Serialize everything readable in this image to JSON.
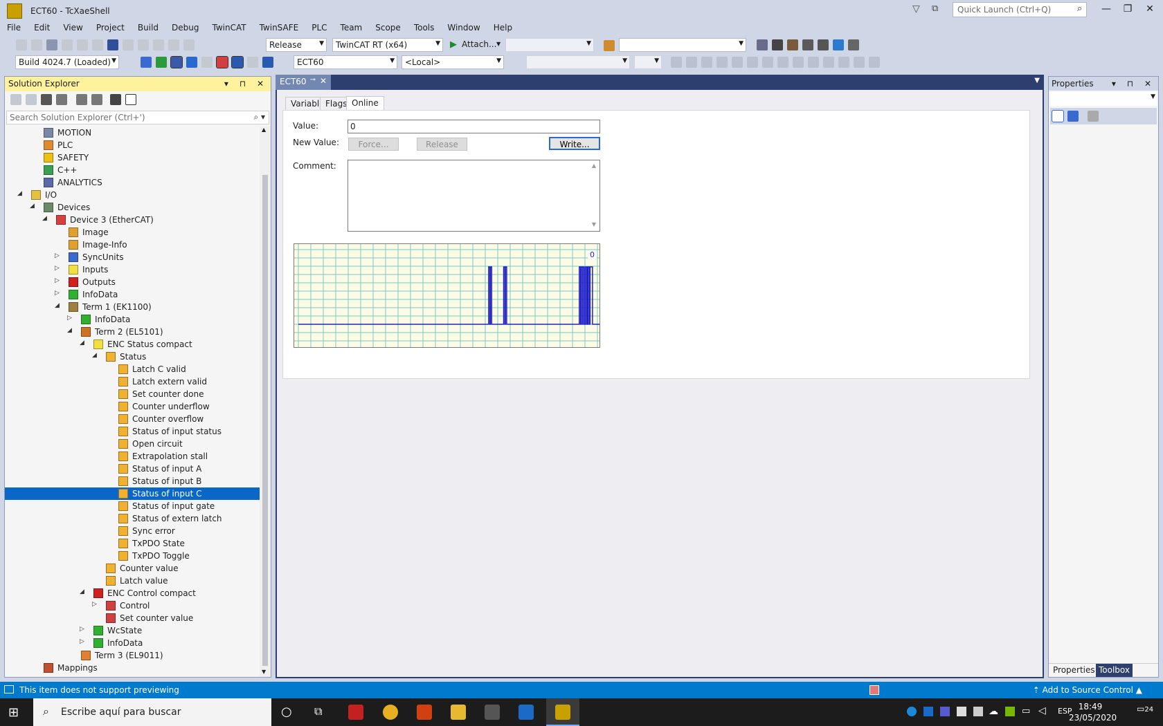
{
  "window": {
    "title": "ECT60 - TcXaeShell",
    "quick_launch_placeholder": "Quick Launch (Ctrl+Q)"
  },
  "menu": [
    "File",
    "Edit",
    "View",
    "Project",
    "Build",
    "Debug",
    "TwinCAT",
    "TwinSAFE",
    "PLC",
    "Team",
    "Scope",
    "Tools",
    "Window",
    "Help"
  ],
  "toolbar": {
    "configuration": "Release",
    "platform": "TwinCAT RT (x64)",
    "attach_label": "Attach...",
    "build_version": "Build 4024.7 (Loaded)",
    "target_project": "ECT60",
    "target_system": "<Local>"
  },
  "solution_explorer": {
    "title": "Solution Explorer",
    "search_placeholder": "Search Solution Explorer (Ctrl+')",
    "items": [
      {
        "label": "MOTION",
        "icon": "motion-icon",
        "color": "#7a88a8"
      },
      {
        "label": "PLC",
        "icon": "plc-icon",
        "color": "#e08a30"
      },
      {
        "label": "SAFETY",
        "icon": "safety-icon",
        "color": "#f0c010"
      },
      {
        "label": "C++",
        "icon": "cpp-icon",
        "color": "#3aa050"
      },
      {
        "label": "ANALYTICS",
        "icon": "analytics-icon",
        "color": "#5a6aa8"
      },
      {
        "label": "I/O",
        "icon": "io-icon",
        "color": "#e6c040"
      },
      {
        "label": "Devices",
        "icon": "devices-icon",
        "color": "#6a8a6a"
      },
      {
        "label": "Device 3 (EtherCAT)",
        "icon": "ethercat-icon",
        "color": "#d84040"
      },
      {
        "label": "Image",
        "icon": "image-icon",
        "color": "#e0a030"
      },
      {
        "label": "Image-Info",
        "icon": "image-info-icon",
        "color": "#e0a030"
      },
      {
        "label": "SyncUnits",
        "icon": "syncunits-icon",
        "color": "#3a6ad0"
      },
      {
        "label": "Inputs",
        "icon": "inputs-folder-icon",
        "color": "#f0e040"
      },
      {
        "label": "Outputs",
        "icon": "outputs-folder-icon",
        "color": "#d02020"
      },
      {
        "label": "InfoData",
        "icon": "infodata-folder-icon",
        "color": "#30b030"
      },
      {
        "label": "Term 1 (EK1100)",
        "icon": "terminal-icon",
        "color": "#a08040"
      },
      {
        "label": "InfoData",
        "icon": "infodata-folder-icon",
        "color": "#30b030"
      },
      {
        "label": "Term 2 (EL5101)",
        "icon": "terminal-icon",
        "color": "#d07020"
      },
      {
        "label": "ENC Status compact",
        "icon": "input-folder-icon",
        "color": "#f0e040"
      },
      {
        "label": "Status",
        "icon": "input-variable-icon",
        "color": "#f0b030"
      },
      {
        "label": "Latch C valid",
        "icon": "input-variable-icon",
        "color": "#f0b030"
      },
      {
        "label": "Latch extern valid",
        "icon": "input-variable-icon",
        "color": "#f0b030"
      },
      {
        "label": "Set counter done",
        "icon": "input-variable-icon",
        "color": "#f0b030"
      },
      {
        "label": "Counter underflow",
        "icon": "input-variable-icon",
        "color": "#f0b030"
      },
      {
        "label": "Counter overflow",
        "icon": "input-variable-icon",
        "color": "#f0b030"
      },
      {
        "label": "Status of input status",
        "icon": "input-variable-icon",
        "color": "#f0b030"
      },
      {
        "label": "Open circuit",
        "icon": "input-variable-icon",
        "color": "#f0b030"
      },
      {
        "label": "Extrapolation stall",
        "icon": "input-variable-icon",
        "color": "#f0b030"
      },
      {
        "label": "Status of input A",
        "icon": "input-variable-icon",
        "color": "#f0b030"
      },
      {
        "label": "Status of input B",
        "icon": "input-variable-icon",
        "color": "#f0b030"
      },
      {
        "label": "Status of input C",
        "icon": "input-variable-icon",
        "color": "#f0b030"
      },
      {
        "label": "Status of input gate",
        "icon": "input-variable-icon",
        "color": "#f0b030"
      },
      {
        "label": "Status of extern latch",
        "icon": "input-variable-icon",
        "color": "#f0b030"
      },
      {
        "label": "Sync error",
        "icon": "input-variable-icon",
        "color": "#f0b030"
      },
      {
        "label": "TxPDO State",
        "icon": "input-variable-icon",
        "color": "#f0b030"
      },
      {
        "label": "TxPDO Toggle",
        "icon": "input-variable-icon",
        "color": "#f0b030"
      },
      {
        "label": "Counter value",
        "icon": "input-variable-icon",
        "color": "#f0b030"
      },
      {
        "label": "Latch value",
        "icon": "input-variable-icon",
        "color": "#f0b030"
      },
      {
        "label": "ENC Control compact",
        "icon": "output-folder-icon",
        "color": "#d02020"
      },
      {
        "label": "Control",
        "icon": "output-variable-icon",
        "color": "#d04040"
      },
      {
        "label": "Set counter value",
        "icon": "output-variable-icon",
        "color": "#d04040"
      },
      {
        "label": "WcState",
        "icon": "wcstate-folder-icon",
        "color": "#30b030"
      },
      {
        "label": "InfoData",
        "icon": "infodata-folder-icon",
        "color": "#30b030"
      },
      {
        "label": "Term 3 (EL9011)",
        "icon": "terminal-end-icon",
        "color": "#e08030"
      },
      {
        "label": "Mappings",
        "icon": "mappings-icon",
        "color": "#c05030"
      }
    ]
  },
  "document": {
    "tab_title": "ECT60",
    "tabs": [
      "Variable",
      "Flags",
      "Online"
    ],
    "active_tab": "Online",
    "value_label": "Value:",
    "value": "0",
    "new_value_label": "New Value:",
    "force_label": "Force...",
    "release_label": "Release",
    "write_label": "Write...",
    "comment_label": "Comment:",
    "scope_value": "0"
  },
  "chart_data": {
    "type": "line",
    "series": [
      {
        "values": [
          0,
          0,
          0,
          0,
          0,
          0,
          0,
          0,
          0,
          0,
          0,
          0,
          0,
          0,
          0,
          0,
          0,
          0,
          0,
          0,
          0,
          0,
          0,
          0,
          0,
          0,
          0,
          0,
          0,
          0,
          0,
          0,
          0,
          0,
          0,
          0,
          0,
          0,
          0,
          0,
          0,
          0,
          0,
          0,
          0,
          0,
          0,
          0,
          0,
          0,
          0,
          0,
          0,
          0,
          0,
          0,
          0,
          0,
          0,
          0,
          0,
          0,
          0,
          0,
          0,
          0,
          0,
          0,
          0,
          0,
          0,
          0,
          0,
          0,
          0,
          0,
          0,
          0,
          0,
          0,
          0,
          0,
          0,
          0,
          0,
          0,
          0,
          0,
          0,
          0,
          0,
          0,
          0,
          0,
          0,
          0,
          0,
          0,
          0,
          0,
          0,
          0,
          0,
          0,
          0,
          0,
          0,
          0,
          0,
          0,
          0,
          0,
          0,
          0,
          0,
          0,
          0,
          0,
          0,
          0,
          0,
          0,
          0,
          0,
          0,
          0,
          0,
          0,
          0,
          0,
          0,
          0,
          0,
          0,
          0,
          0,
          0,
          0,
          0,
          0,
          0,
          0,
          0,
          0,
          0,
          0,
          0,
          0,
          0,
          0,
          0,
          0,
          0,
          0,
          0,
          0,
          0,
          0,
          0,
          0,
          0,
          0,
          0,
          0,
          0,
          0,
          0,
          0,
          0,
          0,
          0,
          0,
          0,
          0,
          0,
          0,
          0,
          0,
          0,
          0,
          0,
          0,
          0,
          0,
          0,
          0,
          0,
          0,
          0,
          0,
          0,
          0,
          0,
          0,
          0,
          0,
          0,
          0,
          0,
          0,
          0,
          0,
          0,
          0,
          0,
          0,
          0,
          0,
          0,
          0,
          0,
          0,
          0,
          0,
          0,
          0,
          0,
          0,
          0,
          0,
          0,
          0,
          0,
          0,
          0,
          0,
          0,
          0,
          0,
          0,
          0,
          0,
          0,
          0,
          0,
          0,
          0,
          0,
          0,
          0,
          0,
          0,
          0,
          0,
          0,
          0,
          0,
          0,
          0,
          0,
          0,
          0,
          0,
          0,
          0,
          0,
          0,
          0,
          0,
          0,
          0,
          0,
          0,
          0,
          0,
          0,
          0,
          0,
          0,
          0,
          0,
          0,
          0,
          0,
          0,
          0,
          0,
          0,
          0,
          0,
          0,
          0,
          0,
          0,
          0,
          0,
          0,
          0,
          0,
          0,
          0,
          0,
          0,
          0,
          0,
          0,
          0,
          0,
          0,
          0,
          0,
          0,
          0,
          0,
          0,
          0,
          0,
          0,
          0,
          0,
          0,
          0,
          0,
          0,
          0,
          0,
          0,
          1,
          1,
          0,
          1,
          1,
          0,
          0,
          0,
          0,
          0,
          0,
          0,
          0,
          0,
          0,
          0,
          0,
          0,
          0,
          0,
          0,
          0,
          0,
          0,
          0,
          1,
          1,
          0,
          1,
          1,
          0,
          0,
          0,
          0,
          0,
          0,
          0,
          0,
          0,
          0,
          0,
          0,
          0,
          0,
          0,
          0,
          0,
          0,
          0,
          0,
          0,
          0,
          0,
          0,
          0,
          0,
          0,
          0,
          0,
          0,
          0,
          0,
          0,
          0,
          0,
          0,
          0,
          0,
          0,
          0,
          0,
          0,
          0,
          0,
          0,
          0,
          0,
          0,
          0,
          0,
          0,
          0,
          0,
          0,
          0,
          0,
          0,
          0,
          0,
          0,
          0,
          0,
          0,
          0,
          0,
          0,
          0,
          0,
          0,
          0,
          0,
          0,
          0,
          0,
          0,
          0,
          0,
          0,
          0,
          0,
          0,
          0,
          0,
          0,
          0,
          0,
          0,
          0,
          0,
          0,
          0,
          0,
          0,
          0,
          0,
          0,
          0,
          0,
          0,
          0,
          0,
          0,
          0,
          0,
          0,
          0,
          0,
          0,
          0,
          0,
          0,
          0,
          0,
          0,
          0,
          0,
          0,
          0,
          0,
          0,
          0,
          1,
          1,
          0,
          1,
          1,
          0,
          1,
          1,
          0,
          0,
          1,
          1,
          0,
          1,
          0,
          1,
          1,
          0,
          1,
          1,
          1,
          1,
          0,
          0,
          0,
          0,
          0,
          0,
          0,
          0,
          0,
          0,
          0,
          0,
          0,
          0,
          0
        ]
      }
    ],
    "ylim": [
      0,
      1
    ],
    "grid": true
  },
  "properties": {
    "title": "Properties",
    "tab_properties": "Properties",
    "tab_toolbox": "Toolbox"
  },
  "statusbar": {
    "message": "This item does not support previewing",
    "source_control": "Add to Source Control"
  },
  "taskbar": {
    "search_placeholder": "Escribe aquí para buscar",
    "language": "ESP",
    "time": "18:49",
    "date": "23/05/2020",
    "notifications": "24"
  }
}
